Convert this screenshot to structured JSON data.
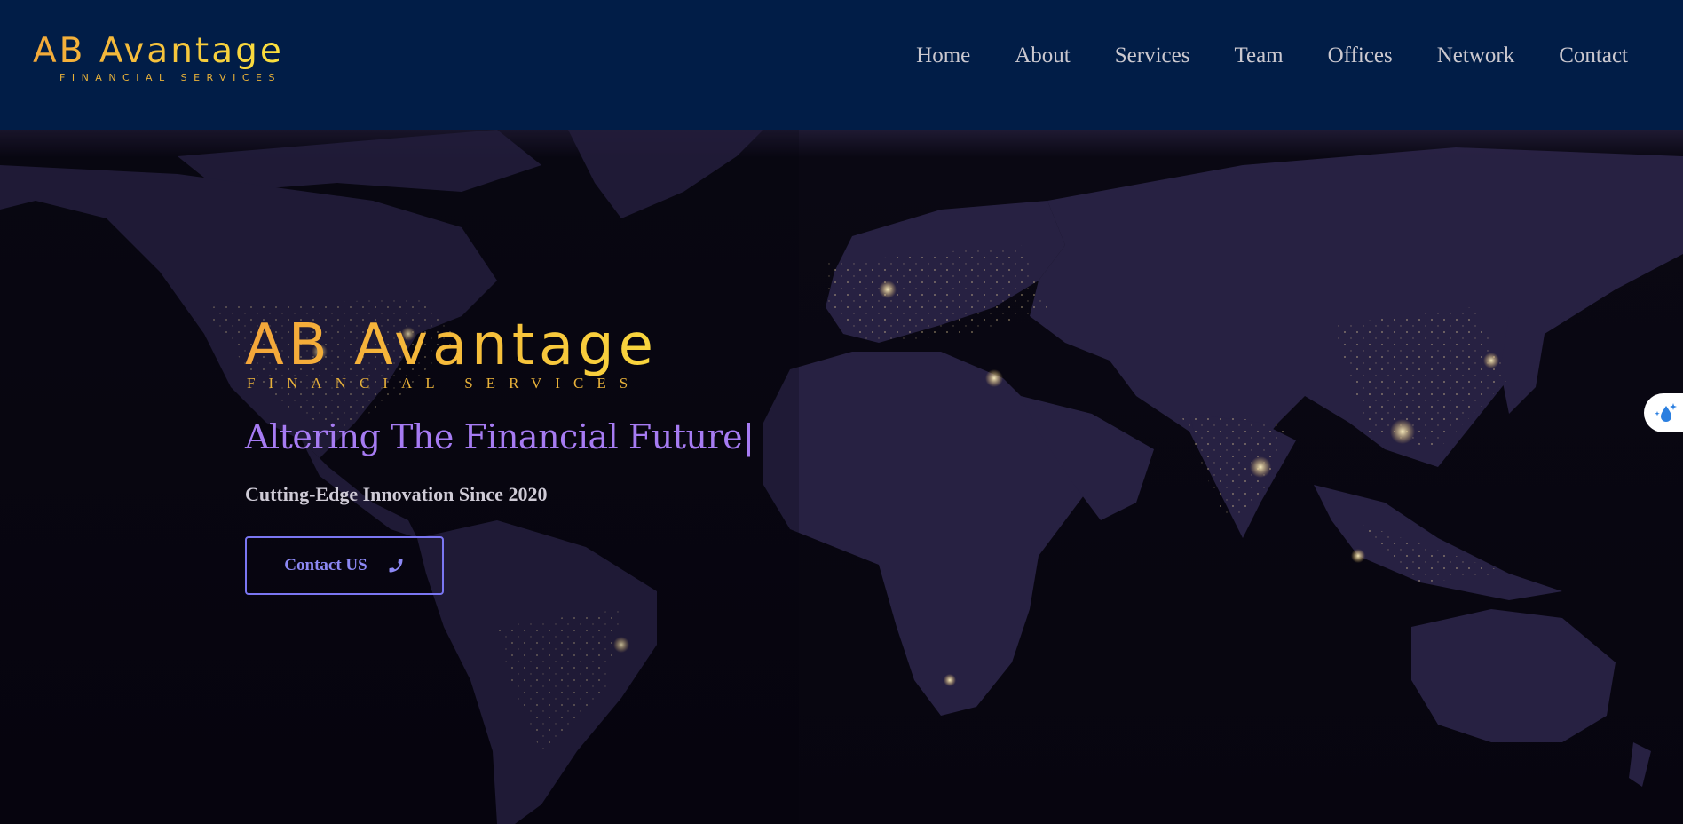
{
  "header": {
    "logo_name": "AB Avantage",
    "logo_tagline": "FINANCIAL SERVICES"
  },
  "nav": {
    "items": [
      "Home",
      "About",
      "Services",
      "Team",
      "Offices",
      "Network",
      "Contact"
    ]
  },
  "hero": {
    "logo_name": "AB Avantage",
    "logo_tagline": "FINANCIAL SERVICES",
    "typed_title": "Altering The Financial Future",
    "cursor": "|",
    "subtitle": "Cutting-Edge Innovation Since 2020",
    "cta_label": "Contact US",
    "cta_icon": "phone-icon"
  },
  "side_widget": {
    "icon": "water-drop-sparkle-icon"
  },
  "colors": {
    "header_bg": "#011d47",
    "gold": "#f6c03b",
    "purple_title": "#a67bf2",
    "button_border": "#7a76f2",
    "nav_text": "#cbc8cf"
  }
}
